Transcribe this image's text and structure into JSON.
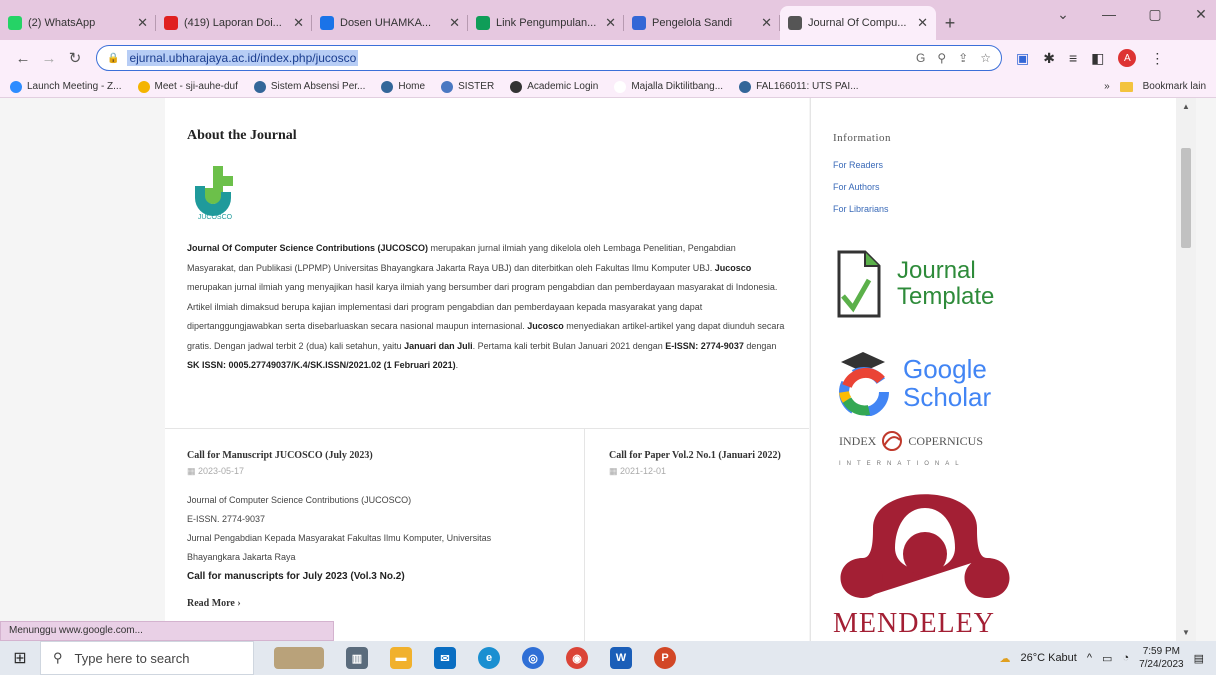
{
  "tabs": [
    {
      "label": "(2) WhatsApp",
      "color": "#25d366",
      "icon": "whatsapp-icon"
    },
    {
      "label": "(419) Laporan Doi...",
      "color": "#e02020",
      "icon": "youtube-icon"
    },
    {
      "label": "Dosen UHAMKA...",
      "color": "#1a73e8",
      "icon": "globe-icon"
    },
    {
      "label": "Link Pengumpulan...",
      "color": "#0f9d58",
      "icon": "drive-icon"
    },
    {
      "label": "Pengelola Sandi",
      "color": "#3367d6",
      "icon": "key-icon"
    },
    {
      "label": "Journal Of Compu...",
      "color": "#555555",
      "icon": "pkp-icon"
    }
  ],
  "url": "ejurnal.ubharajaya.ac.id/index.php/jucosco",
  "bookmarks": [
    {
      "label": "Launch Meeting - Z...",
      "color": "#2d8cff"
    },
    {
      "label": "Meet - sji-auhe-duf",
      "color": "#f4b400"
    },
    {
      "label": "Sistem Absensi Per...",
      "color": "#336699"
    },
    {
      "label": "Home",
      "color": "#336699"
    },
    {
      "label": "SISTER",
      "color": "#4a78c2"
    },
    {
      "label": "Academic Login",
      "color": "#333333"
    },
    {
      "label": "Majalla Diktilitbang...",
      "color": "#ffffff"
    },
    {
      "label": "FAL166011: UTS PAI...",
      "color": "#336699"
    }
  ],
  "bookmarks_other": "Bookmark lain",
  "about": {
    "title": "About the Journal",
    "logo_caption": "JUCOSCO",
    "p1_bold": "Journal Of Computer Science Contributions (JUCOSCO)",
    "p1": " merupakan jurnal ilmiah yang dikelola oleh Lembaga Penelitian, Pengabdian Masyarakat, dan Publikasi  (LPPMP) Universitas Bhayangkara Jakarta Raya UBJ) dan diterbitkan oleh Fakultas Ilmu Komputer UBJ. ",
    "p2_bold": "Jucosco",
    "p2": " merupakan jurnal ilmiah yang menyajikan hasil karya ilmiah yang bersumber dari program pengabdian dan pemberdayaan masyarakat di Indonesia. Artikel ilmiah dimaksud berupa kajian implementasi dari program pengabdian dan pemberdayaan kepada masyarakat yang dapat dipertanggungjawabkan serta disebarluaskan secara nasional maupun internasional. ",
    "p3_bold": "Jucosco",
    "p3": " menyediakan artikel-artikel yang dapat diunduh secara gratis. Dengan jadwal terbit 2 (dua) kali setahun, yaitu ",
    "p4_bold": "Januari dan Juli",
    "p4": ". Pertama kali terbit Bulan Januari 2021 dengan ",
    "p5_bold": "E-ISSN: 2774-9037",
    "p5": " dengan ",
    "p6_bold": "SK ISSN: 0005.27749037/K.4/SK.ISSN/2021.02 (1 Februari 2021)",
    "p6": "."
  },
  "announcements": [
    {
      "title": "Call for Manuscript JUCOSCO (July 2023)",
      "date": "2023-05-17",
      "lines": [
        "Journal of Computer Science Contributions (JUCOSCO)",
        "E-ISSN. 2774-9037",
        "Jurnal Pengabdian Kepada Masyarakat Fakultas Ilmu Komputer, Universitas",
        "Bhayangkara Jakarta Raya"
      ],
      "bold_line": "Call for manuscripts for July 2023 (Vol.3 No.2)",
      "read_more": "Read More"
    },
    {
      "title": "Call for Paper Vol.2 No.1 (Januari 2022)",
      "date": "2021-12-01"
    }
  ],
  "sidebar": {
    "info_title": "Information",
    "links": [
      "For Readers",
      "For Authors",
      "For Librarians"
    ],
    "journal_template_l1": "Journal",
    "journal_template_l2": "Template",
    "gs_l1": "Google",
    "gs_l2": "Scholar",
    "ic_left": "INDEX",
    "ic_right": "COPERNICUS",
    "ic_sub": "INTERNATIONAL",
    "mendeley": "MENDELEY"
  },
  "status_text": "Menunggu www.google.com...",
  "taskbar": {
    "search_placeholder": "Type here to search",
    "weather": "26°C  Kabut",
    "time": "7:59 PM",
    "date": "7/24/2023"
  }
}
